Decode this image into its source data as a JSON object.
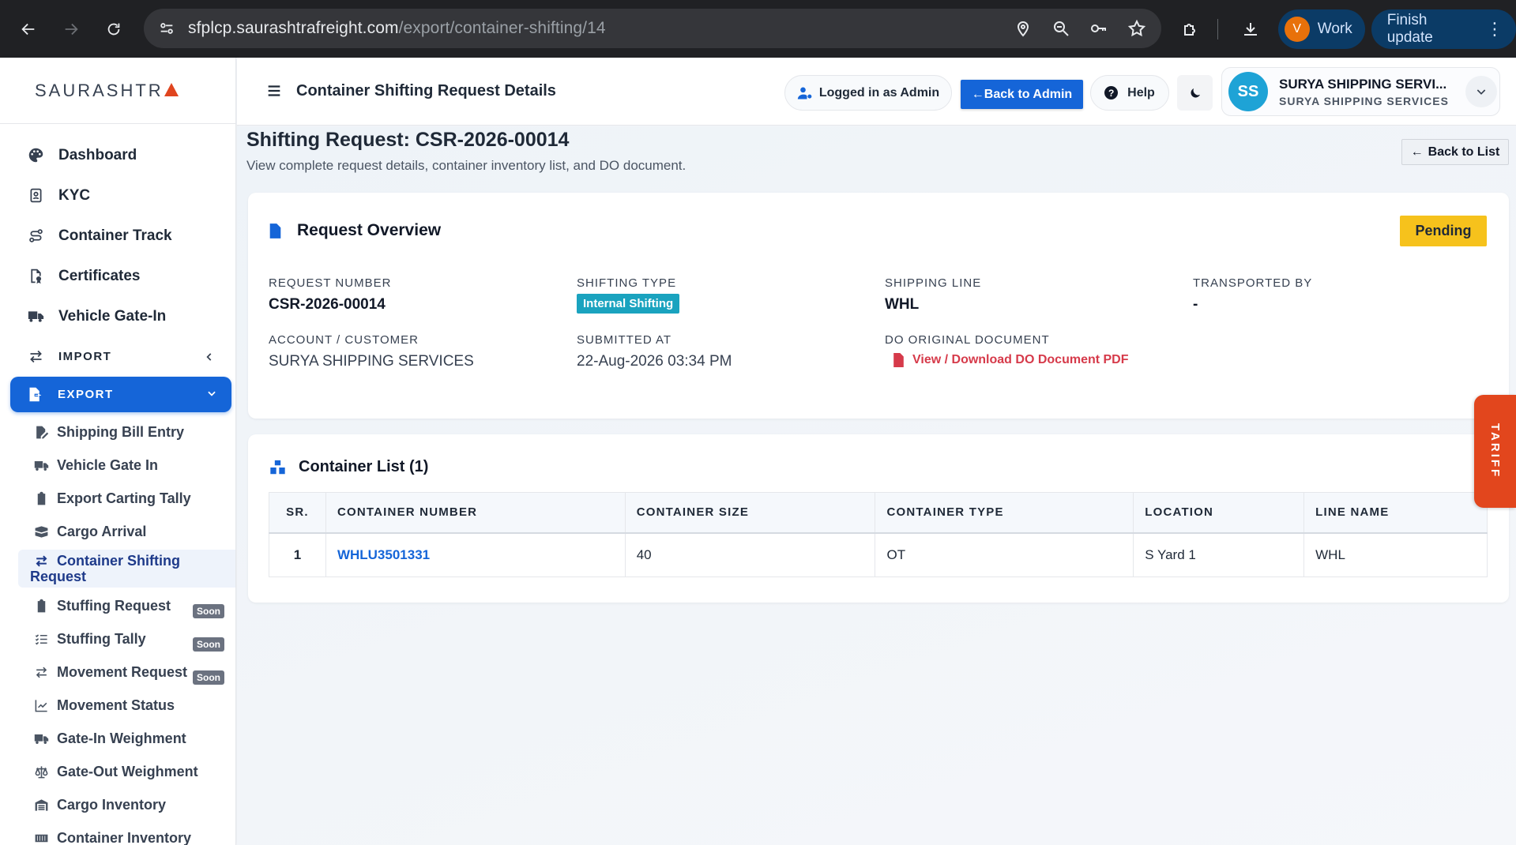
{
  "browser": {
    "url_host": "sfplcp.saurashtrafreight.com",
    "url_path": "/export/container-shifting/14",
    "profile_initial": "V",
    "profile_label": "Work",
    "update_label": "Finish update"
  },
  "brand": {
    "name": "SAURASHTR",
    "accent": "#e0451f"
  },
  "sidebar": {
    "items": [
      {
        "label": "Dashboard",
        "icon": "palette-icon"
      },
      {
        "label": "KYC",
        "icon": "id-badge-icon"
      },
      {
        "label": "Container Track",
        "icon": "route-icon"
      },
      {
        "label": "Certificates",
        "icon": "file-certificate-icon"
      },
      {
        "label": "Vehicle Gate-In",
        "icon": "truck-icon"
      }
    ],
    "import_label": "IMPORT",
    "export_label": "EXPORT",
    "export_sub": [
      {
        "label": "Shipping Bill Entry"
      },
      {
        "label": "Vehicle Gate In"
      },
      {
        "label": "Export Carting Tally"
      },
      {
        "label": "Cargo Arrival"
      },
      {
        "label_line1": "Container Shifting",
        "label_line2": "Request"
      },
      {
        "label": "Stuffing Request",
        "badge": "Soon"
      },
      {
        "label": "Stuffing Tally",
        "badge": "Soon"
      },
      {
        "label": "Movement Request",
        "badge": "Soon"
      },
      {
        "label": "Movement Status"
      },
      {
        "label": "Gate-In Weighment"
      },
      {
        "label": "Gate-Out Weighment"
      },
      {
        "label": "Cargo Inventory"
      },
      {
        "label": "Container Inventory"
      }
    ]
  },
  "header": {
    "title": "Container Shifting Request Details",
    "logged_in": "Logged in as Admin",
    "back_admin": "Back to Admin",
    "help": "Help",
    "user_initials": "SS",
    "user_name": "SURYA SHIPPING SERVI...",
    "user_org": "SURYA SHIPPING SERVICES"
  },
  "page": {
    "heading": "Shifting Request: CSR-2026-00014",
    "subheading": "View complete request details, container inventory list, and DO document.",
    "back_list": "Back to List"
  },
  "overview": {
    "title": "Request Overview",
    "status": "Pending",
    "request_number_label": "REQUEST NUMBER",
    "request_number": "CSR-2026-00014",
    "shifting_type_label": "SHIFTING TYPE",
    "shifting_type": "Internal Shifting",
    "shipping_line_label": "SHIPPING LINE",
    "shipping_line": "WHL",
    "transported_by_label": "TRANSPORTED BY",
    "transported_by": "-",
    "account_label": "ACCOUNT / CUSTOMER",
    "account": "SURYA SHIPPING SERVICES",
    "submitted_label": "SUBMITTED AT",
    "submitted": "22-Aug-2026 03:34 PM",
    "do_label": "DO ORIGINAL DOCUMENT",
    "do_link": "View / Download DO Document PDF"
  },
  "containers": {
    "title": "Container List (1)",
    "headers": [
      "SR.",
      "CONTAINER NUMBER",
      "CONTAINER SIZE",
      "CONTAINER TYPE",
      "LOCATION",
      "LINE NAME"
    ],
    "rows": [
      {
        "sr": "1",
        "number": "WHLU3501331",
        "size": "40",
        "type": "OT",
        "location": "S Yard 1",
        "line": "WHL"
      }
    ]
  },
  "tariff_label": "TARIFF"
}
